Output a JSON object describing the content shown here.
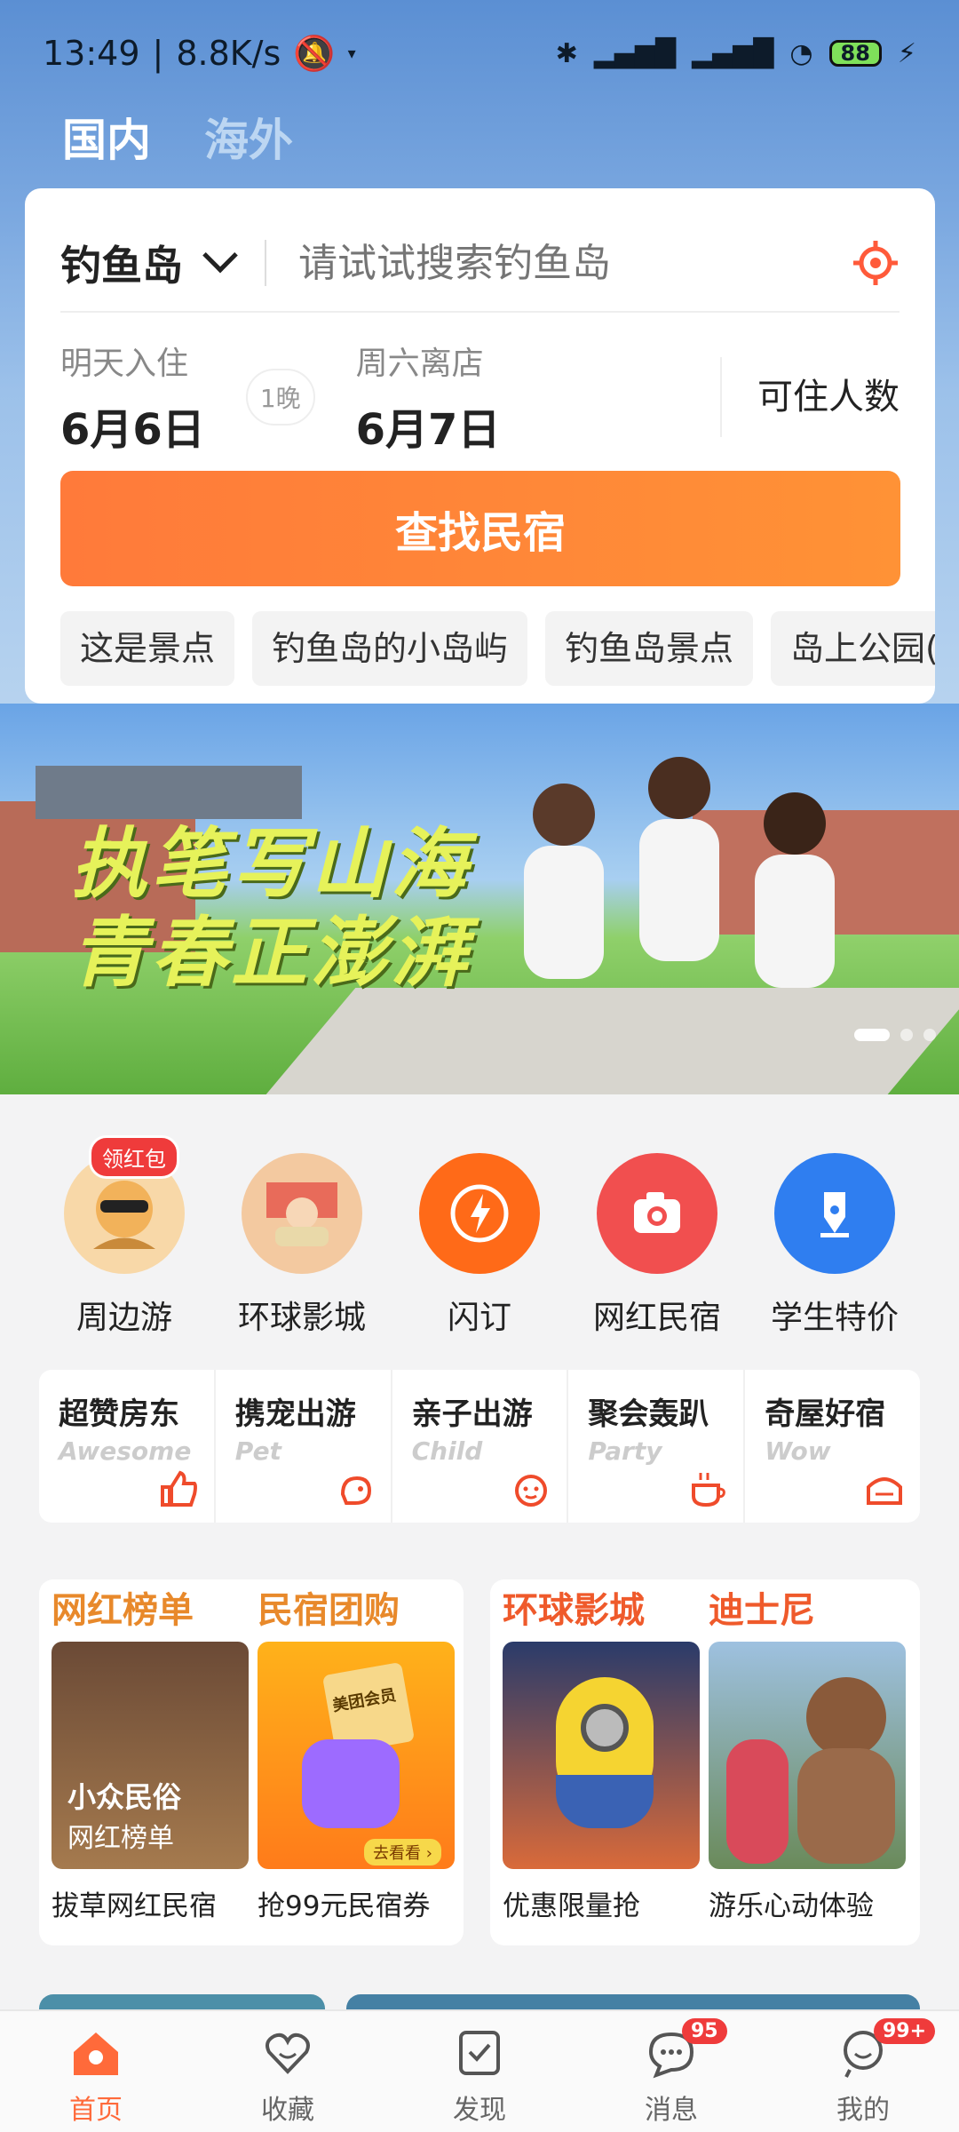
{
  "status_bar": {
    "time": "13:49",
    "speed": "8.8K/s",
    "battery": "88"
  },
  "region_tabs": [
    {
      "label": "国内",
      "active": true
    },
    {
      "label": "海外",
      "active": false
    }
  ],
  "search": {
    "city": "钓鱼岛",
    "placeholder": "请试试搜索钓鱼岛",
    "checkin_label": "明天入住",
    "checkin_date": "6月6日",
    "nights": "1晚",
    "checkout_label": "周六离店",
    "checkout_date": "6月7日",
    "guests_label": "可住人数",
    "button_label": "查找民宿",
    "chips": [
      "这是景点",
      "钓鱼岛的小岛屿",
      "钓鱼岛景点",
      "岛上公园(钅"
    ]
  },
  "banner": {
    "line1": "执笔写山海",
    "line2": "青春正澎湃"
  },
  "categories": [
    {
      "label": "周边游",
      "badge": "领红包"
    },
    {
      "label": "环球影城"
    },
    {
      "label": "闪订"
    },
    {
      "label": "网红民宿"
    },
    {
      "label": "学生特价"
    }
  ],
  "themes": [
    {
      "title": "超赞房东",
      "sub": "Awesome"
    },
    {
      "title": "携宠出游",
      "sub": "Pet"
    },
    {
      "title": "亲子出游",
      "sub": "Child"
    },
    {
      "title": "聚会轰趴",
      "sub": "Party"
    },
    {
      "title": "奇屋好宿",
      "sub": "Wow"
    }
  ],
  "promos": [
    {
      "head": "网红榜单",
      "caption": "拔草网红民宿",
      "overlay1": "小众民俗",
      "overlay2": "网红榜单"
    },
    {
      "head": "民宿团购",
      "caption": "抢99元民宿券",
      "overlay1": "美团会员",
      "overlay2": "去看看 ›"
    },
    {
      "head": "环球影城",
      "caption": "优惠限量抢"
    },
    {
      "head": "迪士尼",
      "caption": "游乐心动体验"
    }
  ],
  "nav": [
    {
      "label": "首页",
      "active": true
    },
    {
      "label": "收藏"
    },
    {
      "label": "发现"
    },
    {
      "label": "消息",
      "badge": "95"
    },
    {
      "label": "我的",
      "badge": "99+"
    }
  ],
  "colors": {
    "accent": "#ff7a3a",
    "promo_head": "#e8892b",
    "badge": "#ef3b3b"
  }
}
